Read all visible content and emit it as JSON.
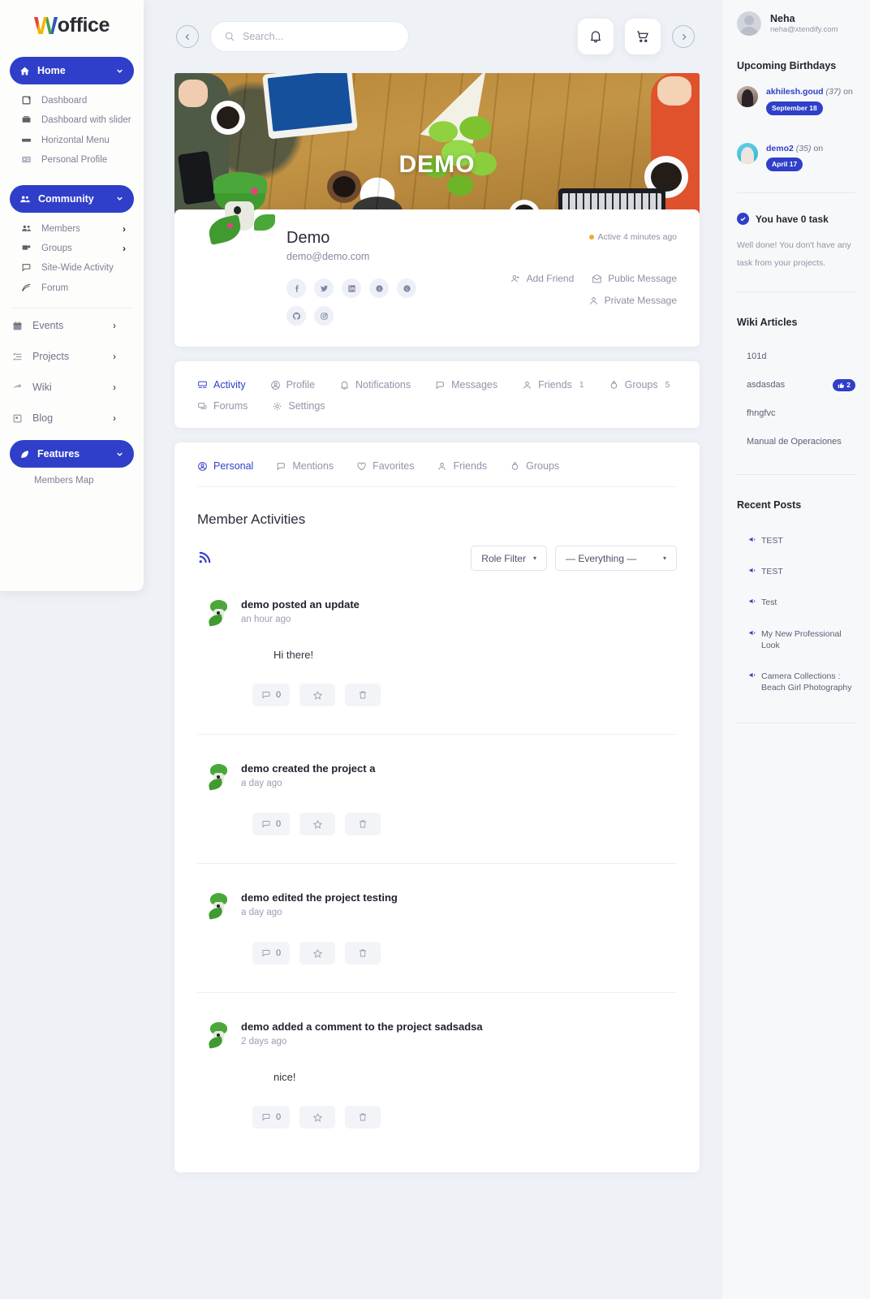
{
  "brand": {
    "first": "W",
    "rest": "office"
  },
  "sidebar": {
    "groups": [
      {
        "label": "Home",
        "icon": "home-icon",
        "expanded": true,
        "items": [
          {
            "label": "Dashboard",
            "icon": "dashboard-icon",
            "arrow": false
          },
          {
            "label": "Dashboard with slider",
            "icon": "slider-icon",
            "arrow": false
          },
          {
            "label": "Horizontal Menu",
            "icon": "menu-icon",
            "arrow": false
          },
          {
            "label": "Personal Profile",
            "icon": "id-card-icon",
            "arrow": false
          }
        ]
      },
      {
        "label": "Community",
        "icon": "people-icon",
        "expanded": true,
        "items": [
          {
            "label": "Members",
            "icon": "members-icon",
            "arrow": true
          },
          {
            "label": "Groups",
            "icon": "groups-icon",
            "arrow": true
          },
          {
            "label": "Site-Wide Activity",
            "icon": "activity-icon",
            "arrow": false
          },
          {
            "label": "Forum",
            "icon": "forum-icon",
            "arrow": false
          }
        ]
      }
    ],
    "rows": [
      {
        "label": "Events",
        "icon": "calendar-icon"
      },
      {
        "label": "Projects",
        "icon": "tasks-icon"
      },
      {
        "label": "Wiki",
        "icon": "wiki-icon"
      },
      {
        "label": "Blog",
        "icon": "blog-icon"
      }
    ],
    "features": {
      "label": "Features",
      "icon": "leaf-icon",
      "sub": "Members Map"
    }
  },
  "topbar": {
    "back_icon": "arrow-left-icon",
    "forward_icon": "arrow-right-icon",
    "search_placeholder": "Search...",
    "search_value": "",
    "notifications_icon": "bell-icon",
    "cart_icon": "cart-icon"
  },
  "cover": {
    "title": "DEMO"
  },
  "profile": {
    "name": "Demo",
    "email": "demo@demo.com",
    "active_status": "Active 4 minutes ago",
    "socials": [
      "facebook",
      "twitter",
      "linkedin",
      "skype",
      "google-plus",
      "github",
      "instagram"
    ],
    "actions": [
      {
        "label": "Add Friend",
        "icon": "user-plus-icon"
      },
      {
        "label": "Public Message",
        "icon": "public-message-icon"
      },
      {
        "label": "Private Message",
        "icon": "private-message-icon"
      }
    ]
  },
  "profile_tabs": [
    {
      "label": "Activity",
      "icon": "activity-icon",
      "active": true,
      "count": ""
    },
    {
      "label": "Profile",
      "icon": "profile-icon",
      "active": false,
      "count": ""
    },
    {
      "label": "Notifications",
      "icon": "bell-icon",
      "active": false,
      "count": ""
    },
    {
      "label": "Messages",
      "icon": "messages-icon",
      "active": false,
      "count": ""
    },
    {
      "label": "Friends",
      "icon": "friends-icon",
      "active": false,
      "count": "1"
    },
    {
      "label": "Groups",
      "icon": "groups-icon",
      "active": false,
      "count": "5"
    },
    {
      "label": "Forums",
      "icon": "forums-icon",
      "active": false,
      "count": ""
    },
    {
      "label": "Settings",
      "icon": "gear-icon",
      "active": false,
      "count": ""
    }
  ],
  "filter_tabs": [
    {
      "label": "Personal",
      "icon": "person-icon",
      "active": true
    },
    {
      "label": "Mentions",
      "icon": "mention-icon",
      "active": false
    },
    {
      "label": "Favorites",
      "icon": "heart-icon",
      "active": false
    },
    {
      "label": "Friends",
      "icon": "friends-icon",
      "active": false
    },
    {
      "label": "Groups",
      "icon": "groups-icon",
      "active": false
    }
  ],
  "feed": {
    "heading": "Member Activities",
    "rss_icon": "rss-icon",
    "role_filter": "Role Filter",
    "everything_filter": "— Everything —",
    "items": [
      {
        "title": "demo posted an update",
        "time": "an hour ago",
        "body": "Hi there!",
        "comments": "0"
      },
      {
        "title": "demo created the project a",
        "time": "a day ago",
        "body": "",
        "comments": "0"
      },
      {
        "title": "demo edited the project testing",
        "time": "a day ago",
        "body": "",
        "comments": "0"
      },
      {
        "title": "demo added a comment to the project sadsadsa",
        "time": "2 days ago",
        "body": "nice!",
        "comments": "0"
      }
    ],
    "btn_star_icon": "star-icon",
    "btn_trash_icon": "trash-icon",
    "btn_comment_icon": "comment-icon"
  },
  "right": {
    "user": {
      "name": "Neha",
      "email": "neha@xtendify.com"
    },
    "birthdays_title": "Upcoming Birthdays",
    "birthdays": [
      {
        "name": "akhilesh.goud",
        "age": "(37)",
        "on": "on",
        "date": "September 18",
        "avatar": "a"
      },
      {
        "name": "demo2",
        "age": "(35)",
        "on": "on",
        "date": "April 17",
        "avatar": "b"
      }
    ],
    "task": {
      "title": "You have 0 task",
      "body": "Well done! You don't have any task from your projects.",
      "icon": "check-circle-icon"
    },
    "wiki_title": "Wiki Articles",
    "wiki_items": [
      {
        "label": "101d",
        "likes": ""
      },
      {
        "label": "asdasdas",
        "likes": "2"
      },
      {
        "label": "fhngfvc",
        "likes": ""
      },
      {
        "label": "Manual de Operaciones",
        "likes": ""
      }
    ],
    "posts_title": "Recent Posts",
    "posts": [
      {
        "label": "TEST"
      },
      {
        "label": "TEST"
      },
      {
        "label": "Test"
      },
      {
        "label": "My New Professional Look"
      },
      {
        "label": "Camera Collections : Beach Girl Photography"
      }
    ],
    "post_icon": "megaphone-icon"
  },
  "colors": {
    "accent": "#2f3fc9",
    "page_bg": "#eef1f6",
    "card": "#ffffff",
    "muted": "#9096a6"
  }
}
